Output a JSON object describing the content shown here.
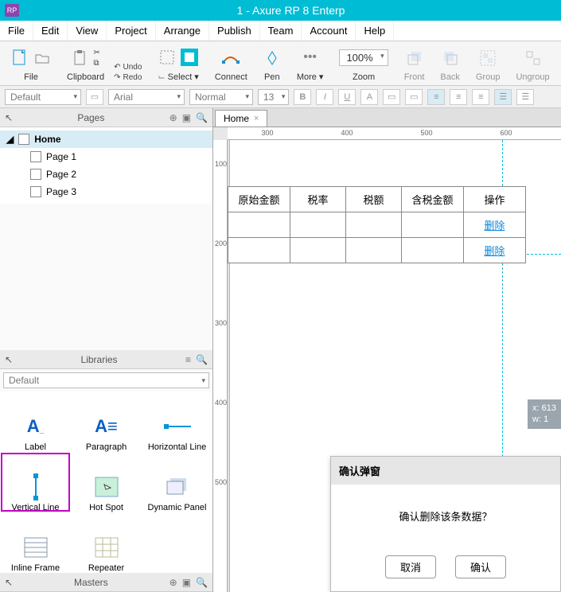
{
  "window": {
    "title": "1 - Axure RP 8 Enterp",
    "logo": "RP"
  },
  "menu": [
    "File",
    "Edit",
    "View",
    "Project",
    "Arrange",
    "Publish",
    "Team",
    "Account",
    "Help"
  ],
  "toolbar": {
    "file": "File",
    "clipboard": "Clipboard",
    "undo": "Undo",
    "redo": "Redo",
    "select": "Select",
    "connect": "Connect",
    "pen": "Pen",
    "more": "More",
    "zoom": "Zoom",
    "zoom_value": "100%",
    "front": "Front",
    "back": "Back",
    "group": "Group",
    "ungroup": "Ungroup"
  },
  "style_row": {
    "preset": "Default",
    "font": "Arial",
    "weight": "Normal",
    "size": "13"
  },
  "pages": {
    "title": "Pages",
    "root": "Home",
    "items": [
      "Page 1",
      "Page 2",
      "Page 3"
    ]
  },
  "libraries": {
    "title": "Libraries",
    "preset": "Default",
    "items": [
      {
        "label": "Label"
      },
      {
        "label": "Paragraph"
      },
      {
        "label": "Horizontal Line"
      },
      {
        "label": "Vertical Line",
        "selected": true
      },
      {
        "label": "Hot Spot"
      },
      {
        "label": "Dynamic Panel"
      },
      {
        "label": "Inline Frame"
      },
      {
        "label": "Repeater"
      }
    ]
  },
  "masters": {
    "title": "Masters"
  },
  "canvas": {
    "tab": "Home",
    "ruler_h": [
      300,
      400,
      500,
      600
    ],
    "ruler_v": [
      100,
      200,
      300,
      400,
      500
    ],
    "table": {
      "headers": [
        "原始金额",
        "税率",
        "税额",
        "含税金额",
        "操作"
      ],
      "rows": [
        {
          "cells": [
            "",
            "",
            "",
            ""
          ],
          "action": "删除"
        },
        {
          "cells": [
            "",
            "",
            "",
            ""
          ],
          "action": "删除"
        }
      ]
    },
    "coords": {
      "x": "x: 613",
      "w": "w: 1"
    },
    "dialog": {
      "title": "确认弹窗",
      "message": "确认删除该条数据？",
      "cancel": "取消",
      "confirm": "确认"
    }
  }
}
